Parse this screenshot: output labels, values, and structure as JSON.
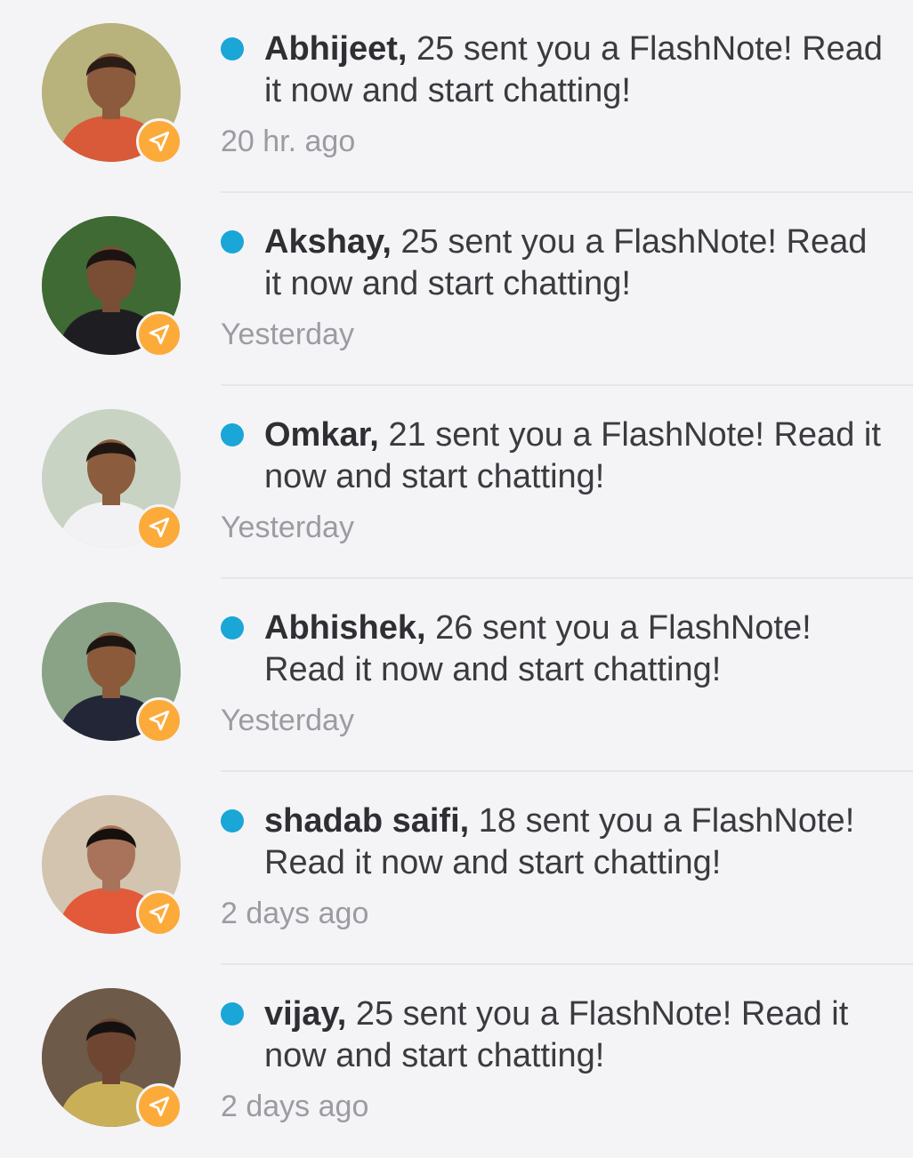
{
  "notifications": [
    {
      "name": "Abhijeet,",
      "age_text": "25",
      "message": " sent you a FlashNote! Read it now and start chatting!",
      "time": "20 hr. ago",
      "avatar_colors": {
        "bg": "#b8b27c",
        "skin": "#8c5a3c",
        "hair": "#2b1d16",
        "shirt": "#d85a38"
      }
    },
    {
      "name": "Akshay,",
      "age_text": "25",
      "message": " sent you a FlashNote! Read it now and start chatting!",
      "time": "Yesterday",
      "avatar_colors": {
        "bg": "#3f6a33",
        "skin": "#7a4e35",
        "hair": "#1c1412",
        "shirt": "#1e1e22"
      }
    },
    {
      "name": "Omkar,",
      "age_text": "21",
      "message": " sent you a FlashNote! Read it now and start chatting!",
      "time": "Yesterday",
      "avatar_colors": {
        "bg": "#c9d3c4",
        "skin": "#8b5c3e",
        "hair": "#1f1612",
        "shirt": "#f2f2f4"
      }
    },
    {
      "name": "Abhishek,",
      "age_text": "26",
      "message": " sent you a FlashNote! Read it now and start chatting!",
      "time": "Yesterday",
      "avatar_colors": {
        "bg": "#8aa387",
        "skin": "#8a5a3b",
        "hair": "#1d1512",
        "shirt": "#222636"
      }
    },
    {
      "name": "shadab saifi,",
      "age_text": "18",
      "message": " sent you a FlashNote! Read it now and start chatting!",
      "time": "2 days ago",
      "avatar_colors": {
        "bg": "#d2c4ae",
        "skin": "#a8735a",
        "hair": "#150f0d",
        "shirt": "#e25a3a"
      }
    },
    {
      "name": "vijay,",
      "age_text": "25",
      "message": " sent you a FlashNote! Read it now and start chatting!",
      "time": "2 days ago",
      "avatar_colors": {
        "bg": "#6d5a48",
        "skin": "#6e4632",
        "hair": "#161111",
        "shirt": "#c9b058"
      }
    }
  ],
  "badge_icon": "send-icon",
  "colors": {
    "unread_dot": "#1aa6d6",
    "badge": "#fcab3a",
    "background": "#f4f4f7"
  }
}
